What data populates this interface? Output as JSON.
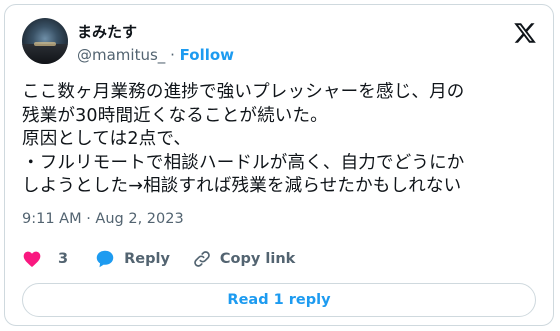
{
  "author": {
    "name": "まみたす",
    "handle": "@mamitus_",
    "separator": "·",
    "follow_label": "Follow"
  },
  "tweet": {
    "text": "ここ数ヶ月業務の進捗で強いプレッシャーを感じ、月の\n残業が30時間近くなることが続いた。\n原因としては2点で、\n・フルリモートで相談ハードルが高く、自力でどうにか\nしようとした→相談すれば残業を減らせたかもしれない",
    "timestamp": "9:11 AM · Aug 2, 2023"
  },
  "actions": {
    "like_count": "3",
    "reply_label": "Reply",
    "copy_label": "Copy link"
  },
  "read_reply_label": "Read 1 reply",
  "icons": [
    "x-logo-icon",
    "heart-icon",
    "reply-bubble-icon",
    "link-icon"
  ],
  "colors": {
    "accent": "#1d9bf0",
    "like": "#f91880",
    "muted": "#536471",
    "border": "#cfd9de"
  }
}
